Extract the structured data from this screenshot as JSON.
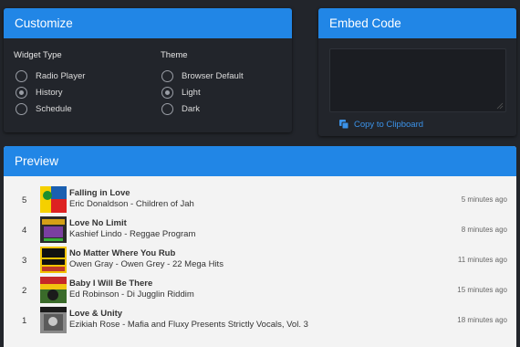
{
  "customize": {
    "title": "Customize",
    "widget_type": {
      "label": "Widget Type",
      "options": [
        {
          "label": "Radio Player",
          "checked": false
        },
        {
          "label": "History",
          "checked": true
        },
        {
          "label": "Schedule",
          "checked": false
        }
      ]
    },
    "theme": {
      "label": "Theme",
      "options": [
        {
          "label": "Browser Default",
          "checked": false
        },
        {
          "label": "Light",
          "checked": true
        },
        {
          "label": "Dark",
          "checked": false
        }
      ]
    }
  },
  "embed": {
    "title": "Embed Code",
    "code_value": "",
    "copy_label": "Copy to Clipboard"
  },
  "preview": {
    "title": "Preview",
    "tracks": [
      {
        "rank": "5",
        "title": "Falling in Love",
        "subtitle": "Eric Donaldson - Children of Jah",
        "time": "5 minutes ago",
        "art_color": "#1a5fb0"
      },
      {
        "rank": "4",
        "title": "Love No Limit",
        "subtitle": "Kashief Lindo - Reggae Program",
        "time": "8 minutes ago",
        "art_color": "#2a2a2a"
      },
      {
        "rank": "3",
        "title": "No Matter Where You Rub",
        "subtitle": "Owen Gray - Owen Grey - 22 Mega Hits",
        "time": "11 minutes ago",
        "art_color": "#f2c300"
      },
      {
        "rank": "2",
        "title": "Baby I Will Be There",
        "subtitle": "Ed Robinson - Di Jugglin Riddim",
        "time": "15 minutes ago",
        "art_color": "#3a6b2a"
      },
      {
        "rank": "1",
        "title": "Love & Unity",
        "subtitle": "Ezikiah Rose - Mafia and Fluxy Presents Strictly Vocals, Vol. 3",
        "time": "18 minutes ago",
        "art_color": "#6a6a6a"
      }
    ]
  }
}
